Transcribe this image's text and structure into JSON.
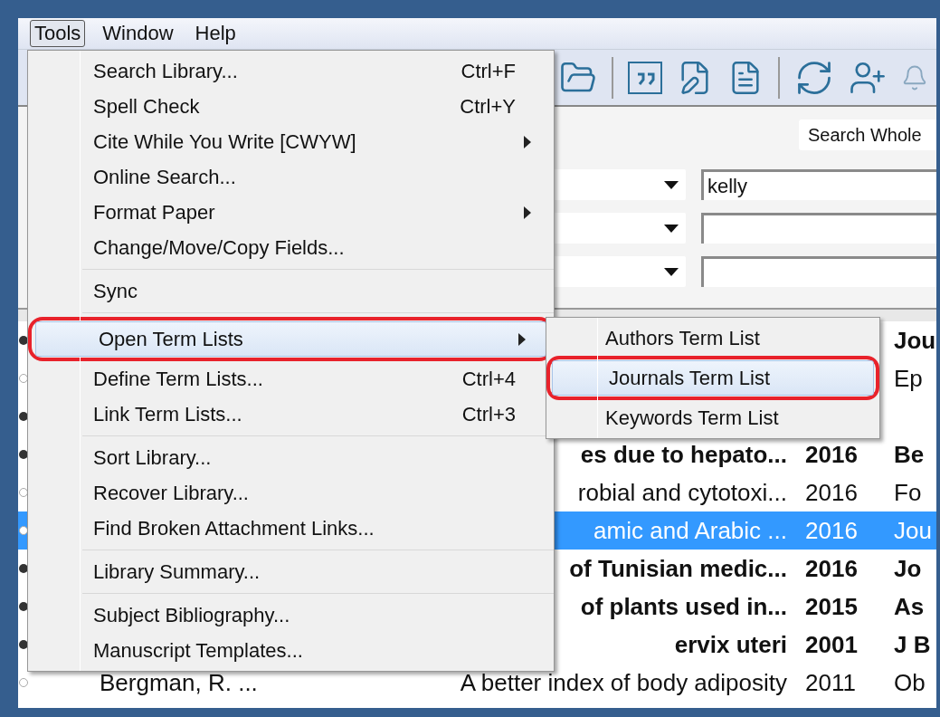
{
  "menu_bar": [
    {
      "label": "Tools",
      "selected": true
    },
    {
      "label": "Window",
      "selected": false
    },
    {
      "label": "Help",
      "selected": false
    }
  ],
  "search_panel": {
    "search_button": "Search Whole",
    "first_field_value": "kelly"
  },
  "tools_menu": {
    "groups": [
      {
        "items": [
          {
            "label": "Search Library...",
            "shortcut": "Ctrl+F",
            "has_submenu": false,
            "highlighted": false
          },
          {
            "label": "Spell Check",
            "shortcut": "Ctrl+Y",
            "has_submenu": false,
            "highlighted": false
          },
          {
            "label": "Cite While You Write [CWYW]",
            "has_submenu": true,
            "highlighted": false
          },
          {
            "label": "Online Search...",
            "has_submenu": false,
            "highlighted": false
          },
          {
            "label": "Format Paper",
            "has_submenu": true,
            "highlighted": false
          },
          {
            "label": "Change/Move/Copy Fields...",
            "has_submenu": false,
            "highlighted": false
          }
        ]
      },
      {
        "items": [
          {
            "label": "Sync",
            "has_submenu": false,
            "highlighted": false
          }
        ]
      },
      {
        "items": [
          {
            "label": "Open Term Lists",
            "has_submenu": true,
            "highlighted": true
          },
          {
            "label": "Define Term Lists...",
            "shortcut": "Ctrl+4",
            "has_submenu": false,
            "highlighted": false
          },
          {
            "label": "Link Term Lists...",
            "shortcut": "Ctrl+3",
            "has_submenu": false,
            "highlighted": false
          }
        ]
      },
      {
        "items": [
          {
            "label": "Sort Library...",
            "has_submenu": false,
            "highlighted": false
          },
          {
            "label": "Recover Library...",
            "has_submenu": false,
            "highlighted": false
          },
          {
            "label": "Find Broken Attachment Links...",
            "has_submenu": false,
            "highlighted": false
          }
        ]
      },
      {
        "items": [
          {
            "label": "Library Summary...",
            "has_submenu": false,
            "highlighted": false
          }
        ]
      },
      {
        "items": [
          {
            "label": "Subject Bibliography...",
            "has_submenu": false,
            "highlighted": false
          },
          {
            "label": "Manuscript Templates...",
            "has_submenu": false,
            "highlighted": false
          }
        ]
      }
    ]
  },
  "term_lists_submenu": {
    "items": [
      {
        "label": "Authors Term List",
        "highlighted": false
      },
      {
        "label": "Journals Term List",
        "highlighted": true
      },
      {
        "label": "Keywords Term List",
        "highlighted": false
      }
    ]
  },
  "references": {
    "rows": [
      {
        "unread": true,
        "selected": false,
        "journal": "Jou"
      },
      {
        "unread": false,
        "selected": false,
        "journal": "Ep"
      },
      {
        "unread": true,
        "selected": false
      },
      {
        "unread": true,
        "selected": false,
        "title": "es due to hepato...",
        "year": "2016",
        "journal": "Be"
      },
      {
        "unread": false,
        "selected": false,
        "title": "robial and cytotoxi...",
        "year": "2016",
        "journal": "Fo"
      },
      {
        "unread": false,
        "selected": true,
        "title": "amic and Arabic ...",
        "year": "2016",
        "journal": "Jou"
      },
      {
        "unread": true,
        "selected": false,
        "title": "of Tunisian medic...",
        "year": "2016",
        "journal": "Jo"
      },
      {
        "unread": true,
        "selected": false,
        "title": "of plants used in...",
        "year": "2015",
        "journal": "As"
      },
      {
        "unread": true,
        "selected": false,
        "title": "ervix uteri",
        "year": "2001",
        "journal": "J B"
      },
      {
        "unread": false,
        "selected": false,
        "author": "Bergman, R. ...",
        "title": "A better index of body adiposity",
        "year": "2011",
        "journal": "Ob"
      }
    ]
  }
}
